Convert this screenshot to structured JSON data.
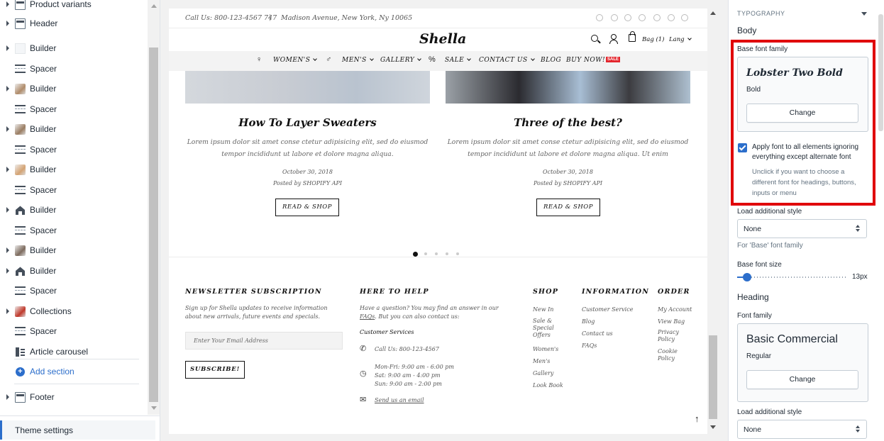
{
  "sidebar": {
    "items": [
      {
        "label": "Product variants",
        "icon": "section-icon"
      },
      {
        "label": "Header",
        "icon": "section-icon"
      },
      {
        "label": "Builder",
        "icon": "blank-thumb"
      },
      {
        "label": "Spacer",
        "icon": "spacer-icon"
      },
      {
        "label": "Builder",
        "icon": "photo-thumb"
      },
      {
        "label": "Spacer",
        "icon": "spacer-icon"
      },
      {
        "label": "Builder",
        "icon": "photo-thumb"
      },
      {
        "label": "Spacer",
        "icon": "spacer-icon"
      },
      {
        "label": "Builder",
        "icon": "photo-thumb"
      },
      {
        "label": "Spacer",
        "icon": "spacer-icon"
      },
      {
        "label": "Builder",
        "icon": "house-icon"
      },
      {
        "label": "Spacer",
        "icon": "spacer-icon"
      },
      {
        "label": "Builder",
        "icon": "photo-thumb"
      },
      {
        "label": "Builder",
        "icon": "house-icon"
      },
      {
        "label": "Spacer",
        "icon": "spacer-icon"
      },
      {
        "label": "Collections",
        "icon": "photo-thumb"
      },
      {
        "label": "Spacer",
        "icon": "spacer-icon"
      },
      {
        "label": "Article carousel",
        "icon": "article-icon"
      }
    ],
    "add_section": "Add section",
    "footer": "Footer",
    "theme_settings": "Theme settings"
  },
  "preview": {
    "topbar": {
      "call": "Call Us: 800-123-4567 747",
      "pipe": "|",
      "address": "Madison Avenue, New York, Ny 10065"
    },
    "logo": "Shella",
    "bag": "Bag (1)",
    "lang": "Lang",
    "nav": [
      "WOMEN'S",
      "MEN'S",
      "GALLERY",
      "SALE",
      "CONTACT US",
      "BLOG",
      "BUY NOW!"
    ],
    "sale_badge": "SALE",
    "posts": [
      {
        "title": "How To Layer Sweaters",
        "text": "Lorem ipsum dolor sit amet conse ctetur adipisicing elit, sed do eiusmod tempor incididunt ut labore et dolore magna aliqua.",
        "date": "October 30, 2018",
        "by": "Posted by SHOPIFY API",
        "button": "READ & SHOP"
      },
      {
        "title": "Three of the best?",
        "text": "Lorem ipsum dolor sit amet conse ctetur adipisicing elit, sed do eiusmod tempor incididunt ut labore et dolore magna aliqua. Ut enim",
        "date": "October 30, 2018",
        "by": "Posted by SHOPIFY API",
        "button": "READ & SHOP"
      }
    ],
    "footer": {
      "newsletter_title": "NEWSLETTER SUBSCRIPTION",
      "newsletter_text": "Sign up for Shella updates to receive information about new arrivals, future events and specials.",
      "email_placeholder": "Enter Your Email Address",
      "subscribe": "SUBSCRIBE!",
      "help_title": "HERE TO HELP",
      "help_text_1": "Have a question? You may find an answer in our",
      "help_faq_link": "FAQs",
      "help_text_2": "But you can also contact us:",
      "customer_services": "Customer Services",
      "phone": "Call Us: 800-123-4567",
      "hours_1": "Mon-Fri: 9:00 am - 6:00 pm",
      "hours_2": "Sat: 9:00 am - 4:00 pm",
      "hours_3": "Sun: 9:00 am - 2:00 pm",
      "email_link": "Send us an email",
      "shop_title": "SHOP",
      "shop_links": [
        "New In",
        "Sale & Special Offers",
        "Women's",
        "Men's",
        "Gallery",
        "Look Book"
      ],
      "info_title": "INFORMATION",
      "info_links": [
        "Customer Service",
        "Blog",
        "Contact us",
        "FAQs"
      ],
      "order_title": "ORDER",
      "order_links": [
        "My Account",
        "View Bag",
        "Privacy Policy",
        "Cookie Policy"
      ]
    }
  },
  "settings": {
    "section_title": "TYPOGRAPHY",
    "body_heading": "Body",
    "base_font_family_label": "Base font family",
    "base_font_name": "Lobster Two Bold",
    "base_font_variant": "Bold",
    "change_label": "Change",
    "apply_all_label": "Apply font to all elements ignoring everything except alternate font",
    "apply_all_checked": true,
    "apply_all_hint": "Unclick if you want to choose a different font for headings, buttons, inputs or menu",
    "load_additional_style_label": "Load additional style",
    "load_additional_style_value": "None",
    "base_style_hint": "For 'Base' font family",
    "base_font_size_label": "Base font size",
    "base_font_size_value": "13px",
    "base_font_size_level": 0.1,
    "heading_heading": "Heading",
    "font_family_label": "Font family",
    "heading_font_name": "Basic Commercial",
    "heading_font_variant": "Regular",
    "heading_change_label": "Change",
    "heading_load_style_label": "Load additional style",
    "heading_load_style_value": "None"
  },
  "colors": {
    "accent": "#2c6ecb",
    "highlight": "#e0000a",
    "sale": "#e4272e"
  }
}
